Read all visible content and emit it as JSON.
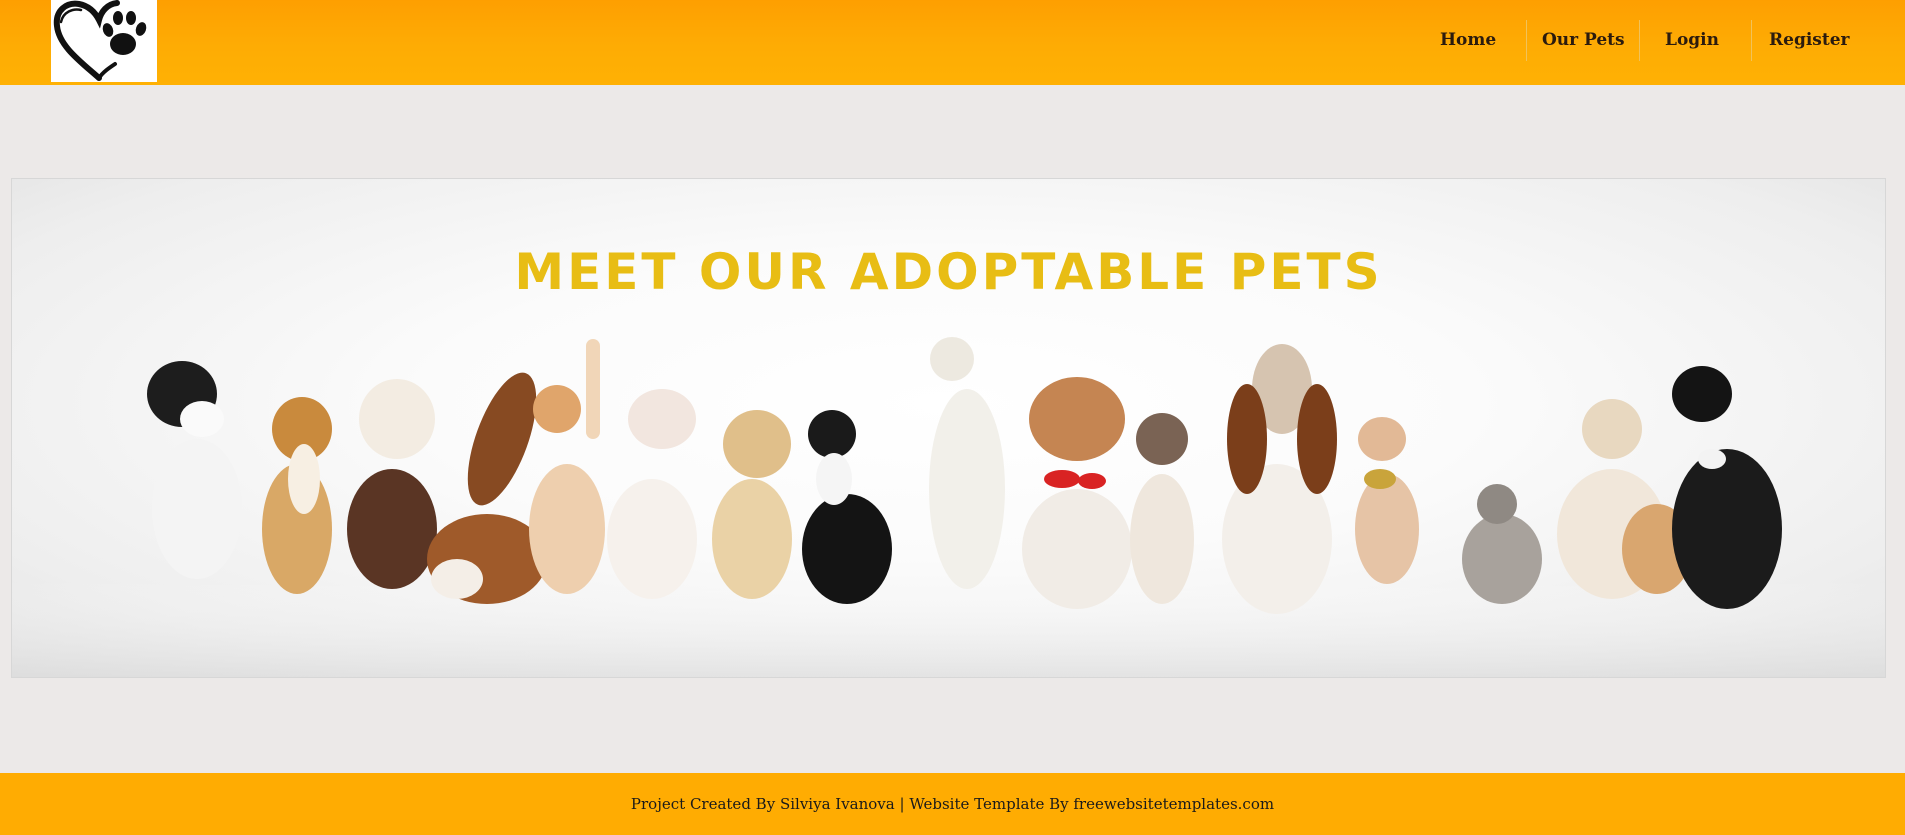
{
  "header": {
    "logo_icon": "heart-paw-icon",
    "nav": [
      {
        "label": "Home"
      },
      {
        "label": "Our Pets"
      },
      {
        "label": "Login"
      },
      {
        "label": "Register"
      }
    ]
  },
  "banner": {
    "title": "MEET OUR ADOPTABLE PETS",
    "image": "adoptable-pets-photo"
  },
  "footer": {
    "text": "Project Created By Silviya Ivanova | Website Template By freewebsitetemplates.com"
  },
  "colors": {
    "header_top": "#fe9f01",
    "header_bottom": "#ffb104",
    "page_bg": "#ece9e8",
    "banner_title": "#e8bd14",
    "footer_bg": "#ffac02"
  }
}
